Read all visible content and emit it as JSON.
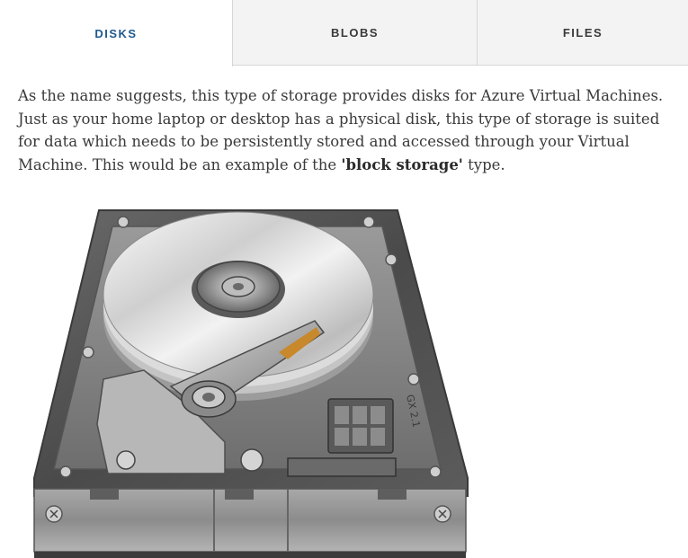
{
  "tabs": [
    {
      "label": "DISKS",
      "active": true
    },
    {
      "label": "BLOBS",
      "active": false
    },
    {
      "label": "FILES",
      "active": false
    }
  ],
  "content": {
    "text_before": "As the name suggests, this type of storage provides disks for Azure Virtual Machines. Just as your home laptop or desktop has a physical disk, this type of storage is suited for data which needs to be persistently stored and accessed through your Virtual Machine. This would be an example of the ",
    "bold_text": "'block storage'",
    "text_after": " type."
  },
  "illustration": {
    "icon": "hard-disk-drive-icon",
    "label": "GX 2.1"
  },
  "colors": {
    "active_tab_text": "#1e5a8e",
    "tab_text": "#3a3a3a",
    "inactive_tab_bg": "#f3f3f3",
    "body_text": "#3a3a3a"
  }
}
